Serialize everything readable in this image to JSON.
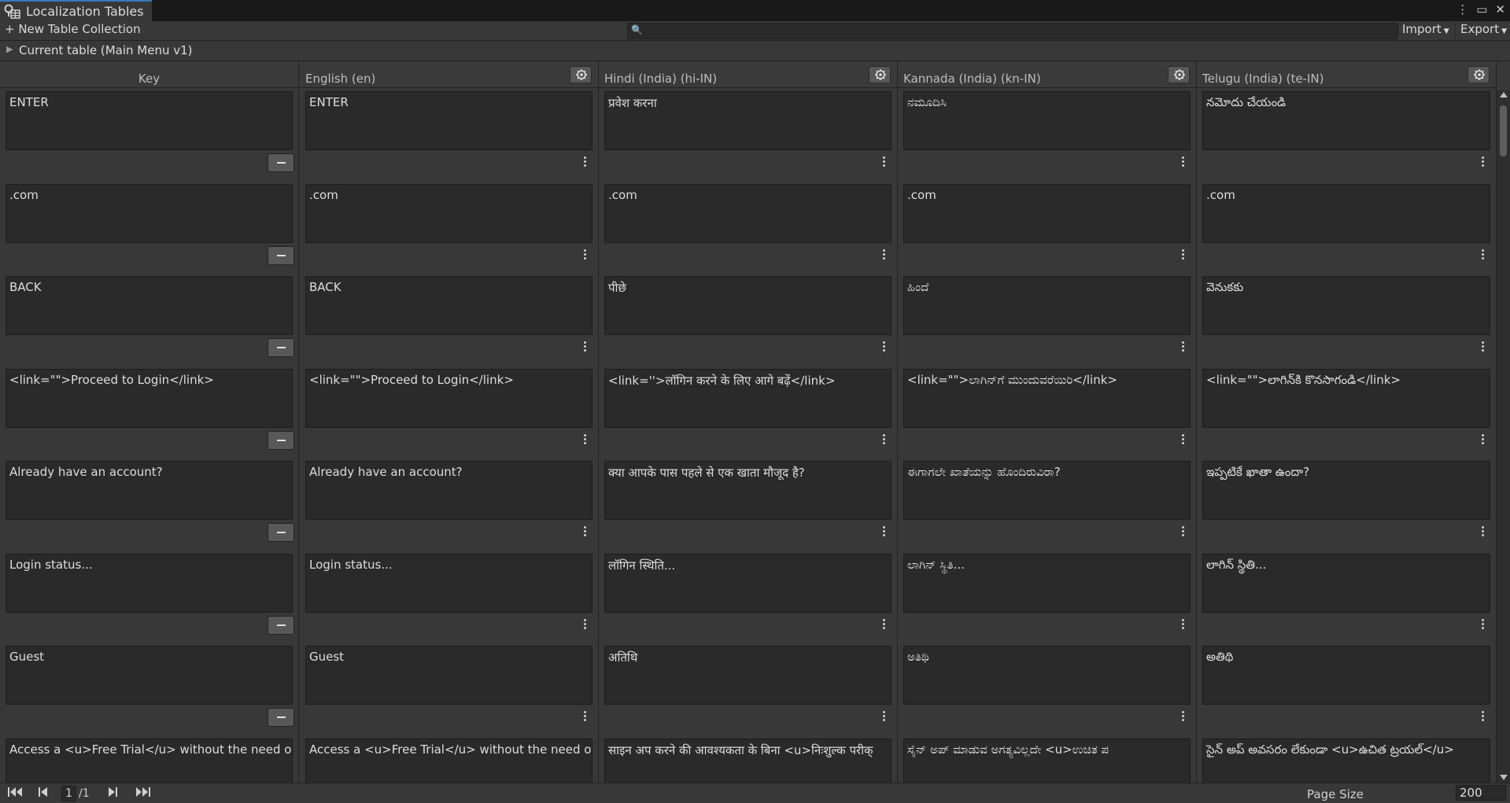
{
  "window": {
    "tab_title": "Localization Tables",
    "controls": [
      "more-icon",
      "maximize-icon",
      "close-icon"
    ]
  },
  "toolbar": {
    "new_collection": "+ New Table Collection",
    "search_value": "",
    "import_label": "Import",
    "export_label": "Export"
  },
  "current_table": {
    "label": "Current table (Main Menu v1)"
  },
  "columns": [
    {
      "name": "Key"
    },
    {
      "name": "English (en)"
    },
    {
      "name": "Hindi (India) (hi-IN)"
    },
    {
      "name": "Kannada (India) (kn-IN)"
    },
    {
      "name": "Telugu (India) (te-IN)"
    }
  ],
  "rows": [
    {
      "cells": [
        "ENTER",
        "ENTER",
        "प्रवेश करना",
        "ನಮೂದಿಸಿ",
        "నమోదు చేయండి"
      ]
    },
    {
      "cells": [
        ".com",
        ".com",
        ".com",
        ".com",
        ".com"
      ]
    },
    {
      "cells": [
        "BACK",
        "BACK",
        "पीछे",
        "ಹಿಂದೆ",
        "వెనుకకు"
      ]
    },
    {
      "cells": [
        "<link=\"\">Proceed to Login</link>",
        "<link=\"\">Proceed to Login</link>",
        "<link=''>लॉगिन करने के लिए आगे बढ़ें</link>",
        "<link=\"\">ಲಾಗಿನ್‌ಗೆ ಮುಂದುವರೆಯಿರಿ</link>",
        "<link=\"\">లాగిన్‌కి కొనసాగండి</link>"
      ]
    },
    {
      "cells": [
        "Already have an account?",
        "Already have an account?",
        "क्या आपके पास पहले से एक खाता मौजूद है?",
        "ಈಗಾಗಲೇ ಖಾತೆಯನ್ನು ಹೊಂದಿರುವಿರಾ?",
        "ఇప్పటికే ఖాతా ఉందా?"
      ]
    },
    {
      "cells": [
        "Login status...",
        "Login status...",
        "लॉगिन स्थिति...",
        "ಲಾಗಿನ್ ಸ್ಥಿತಿ...",
        "లాగిన్ స్థితి..."
      ]
    },
    {
      "cells": [
        "Guest",
        "Guest",
        "अतिथि",
        "ಅತಿಥಿ",
        "అతిథి"
      ]
    },
    {
      "cells": [
        "Access a <u>Free Trial</u> without the need of si",
        "Access a <u>Free Trial</u> without the need of si",
        "साइन अप करने की आवश्यकता के बिना <u>निःशुल्क परीक्",
        "ಸೈನ್ ಅಪ್ ಮಾಡುವ ಅಗತ್ಯವಿಲ್ಲದೇ <u>ಉಚಿತ ಪ",
        "సైన్ అప్ అవసరం లేకుండా <u>ఉచిత ట్రయల్</u>"
      ]
    }
  ],
  "footer": {
    "page_current": "1",
    "page_total": "/1",
    "page_size_label": "Page Size",
    "page_size_value": "200"
  }
}
